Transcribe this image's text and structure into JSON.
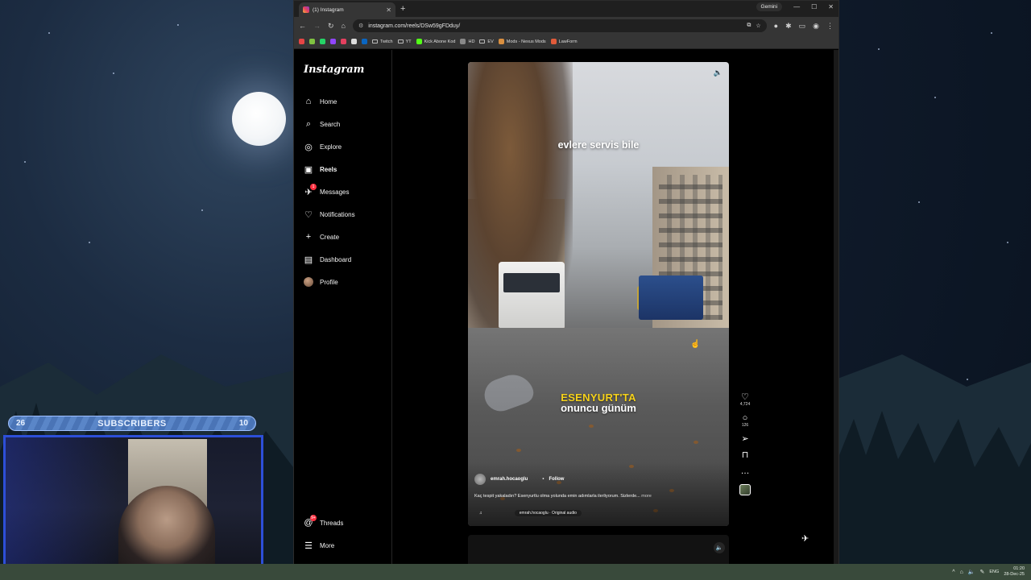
{
  "overlay": {
    "subscribers_left": "26",
    "subscribers_label": "SUBSCRIBERS",
    "subscribers_right": "10"
  },
  "browser": {
    "tab_title": "(1) Instagram",
    "gemini_label": "Gemini",
    "url": "instagram.com/reels/DSw59gFDduy/",
    "bookmarks": [
      "Twitch",
      "YT",
      "Kick Abone Kod",
      "HD",
      "EV",
      "Mods - Nexus Mods",
      "LawForm"
    ]
  },
  "instagram": {
    "logo": "Instagram",
    "nav": [
      {
        "label": "Home",
        "icon": "home-icon"
      },
      {
        "label": "Search",
        "icon": "search-icon"
      },
      {
        "label": "Explore",
        "icon": "explore-icon"
      },
      {
        "label": "Reels",
        "icon": "reels-icon"
      },
      {
        "label": "Messages",
        "icon": "messages-icon",
        "badge": "1"
      },
      {
        "label": "Notifications",
        "icon": "heart-icon"
      },
      {
        "label": "Create",
        "icon": "plus-icon"
      },
      {
        "label": "Dashboard",
        "icon": "dashboard-icon"
      },
      {
        "label": "Profile",
        "icon": "avatar"
      }
    ],
    "nav_bottom": [
      {
        "label": "Threads",
        "icon": "threads-icon",
        "badge": "9+"
      },
      {
        "label": "More",
        "icon": "menu-icon"
      }
    ],
    "reel": {
      "caption_top": "evlere servis bile",
      "caption_yellow": "ESENYURT'TA",
      "caption_white": "onuncu günüm",
      "author": "emrah.hocaoglu",
      "follow": "Follow",
      "description": "Kaç tespit yakaladın? Esenyurtlu olma yolunda emin adımlarla ilerliyorum. Sizlerde...",
      "more": "more",
      "audio": "emrah.hocaoglu · Original audio",
      "likes": "4,724",
      "comments": "126"
    }
  },
  "taskbar": {
    "lang": "ENG",
    "time": "01:20",
    "date": "28-Dec-25"
  }
}
